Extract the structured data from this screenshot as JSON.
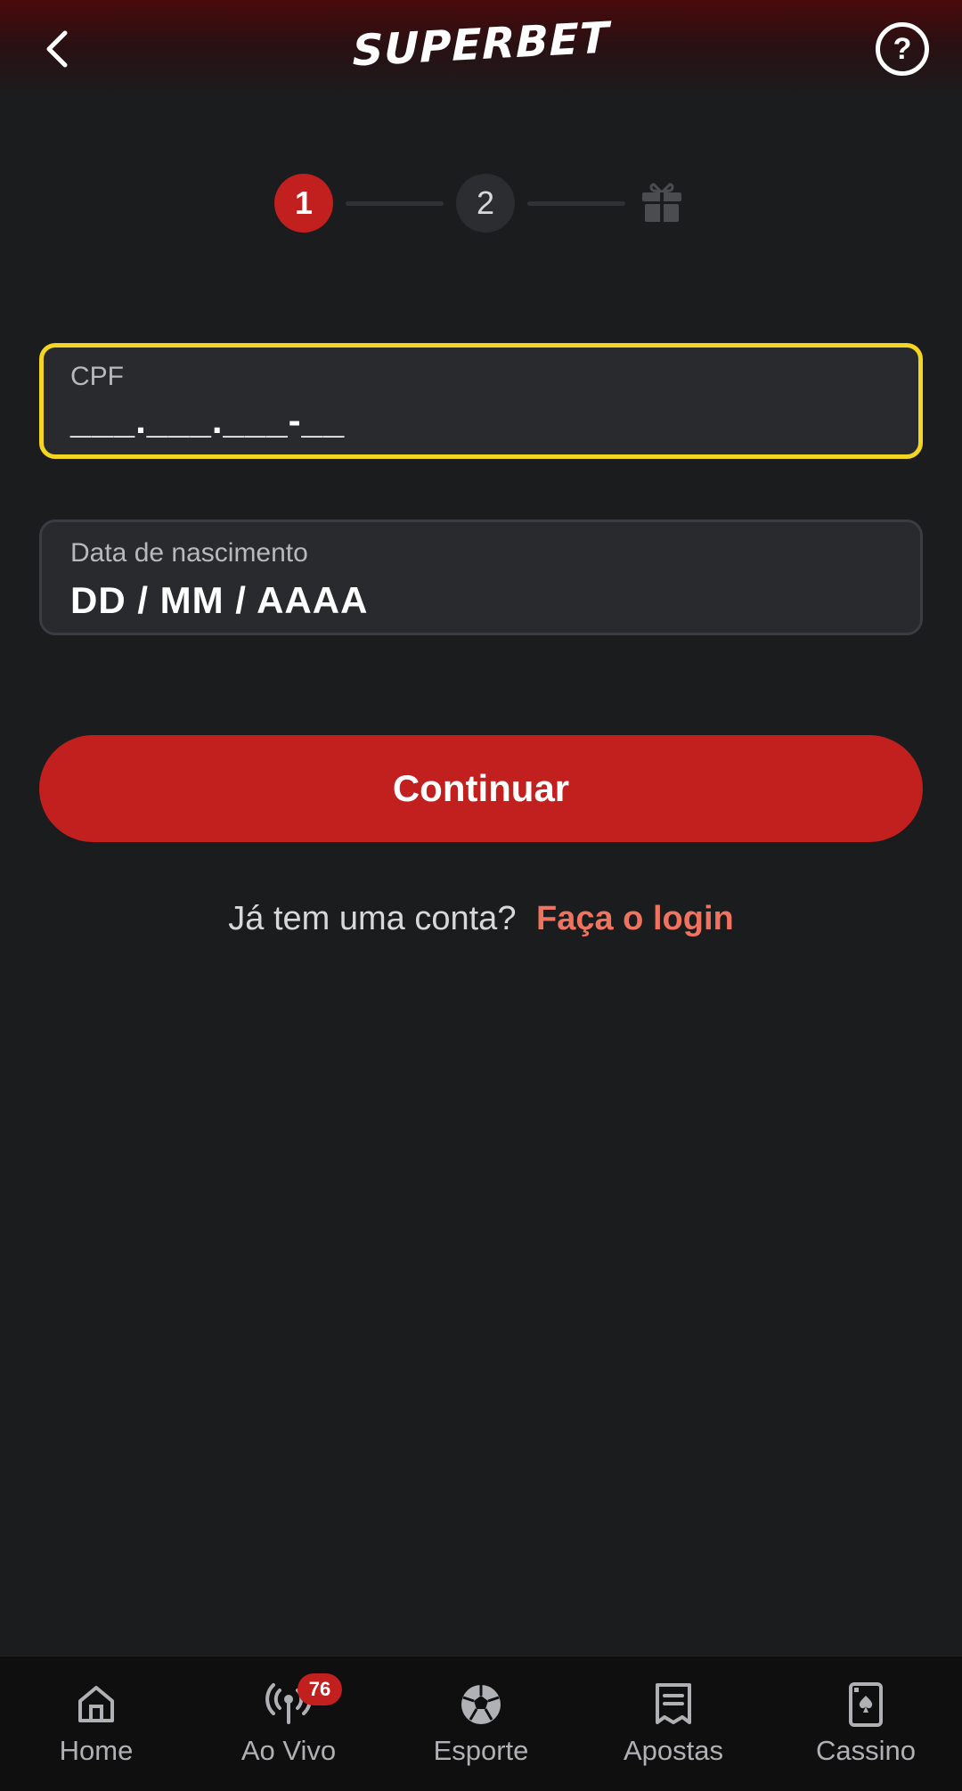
{
  "header": {
    "logo_text": "SUPERBET",
    "help_label": "?"
  },
  "stepper": {
    "step1": "1",
    "step2": "2",
    "final_icon": "gift-icon",
    "active_color": "#c21f1f"
  },
  "form": {
    "cpf": {
      "label": "CPF",
      "value": "___.___.___-__"
    },
    "dob": {
      "label": "Data de nascimento",
      "value": "DD / MM / AAAA"
    },
    "active_border_color": "#f2d622"
  },
  "continue_button": "Continuar",
  "login": {
    "prompt": "Já tem uma conta?",
    "link": "Faça o login"
  },
  "bottom_nav": {
    "items": [
      {
        "label": "Home",
        "icon": "home-icon"
      },
      {
        "label": "Ao Vivo",
        "icon": "live-broadcast-icon",
        "badge": "76"
      },
      {
        "label": "Esporte",
        "icon": "soccer-ball-icon"
      },
      {
        "label": "Apostas",
        "icon": "bet-slip-icon"
      },
      {
        "label": "Cassino",
        "icon": "playing-card-icon"
      }
    ]
  }
}
